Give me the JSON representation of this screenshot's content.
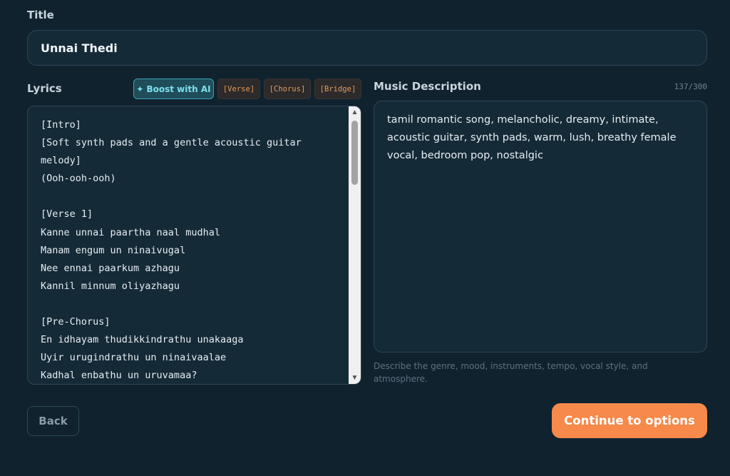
{
  "title": {
    "label": "Title",
    "value": "Unnai Thedi"
  },
  "lyrics": {
    "label": "Lyrics",
    "boost_icon": "✦",
    "boost_label": "Boost with AI",
    "tags": [
      "[Verse]",
      "[Chorus]",
      "[Bridge]"
    ],
    "text": "[Intro]\n[Soft synth pads and a gentle acoustic guitar\nmelody]\n(Ooh-ooh-ooh)\n\n[Verse 1]\nKanne unnai paartha naal mudhal\nManam engum un ninaivugal\nNee ennai paarkum azhagu\nKannil minnum oliyazhagu\n\n[Pre-Chorus]\nEn idhayam thudikkindrathu unakaaga\nUyir urugindrathu un ninaivaalae\nKadhal enbathu un uruvamaa?"
  },
  "music_description": {
    "label": "Music Description",
    "char_count": "137/300",
    "value": "tamil romantic song, melancholic, dreamy, intimate, acoustic guitar, synth pads, warm, lush, breathy female vocal, bedroom pop, nostalgic",
    "helper": "Describe the genre, mood, instruments, tempo, vocal style, and atmosphere."
  },
  "footer": {
    "back_label": "Back",
    "continue_label": "Continue to options"
  },
  "colors": {
    "background": "#10222e",
    "accent": "#f7894a",
    "boost": "#3aa3b5"
  }
}
